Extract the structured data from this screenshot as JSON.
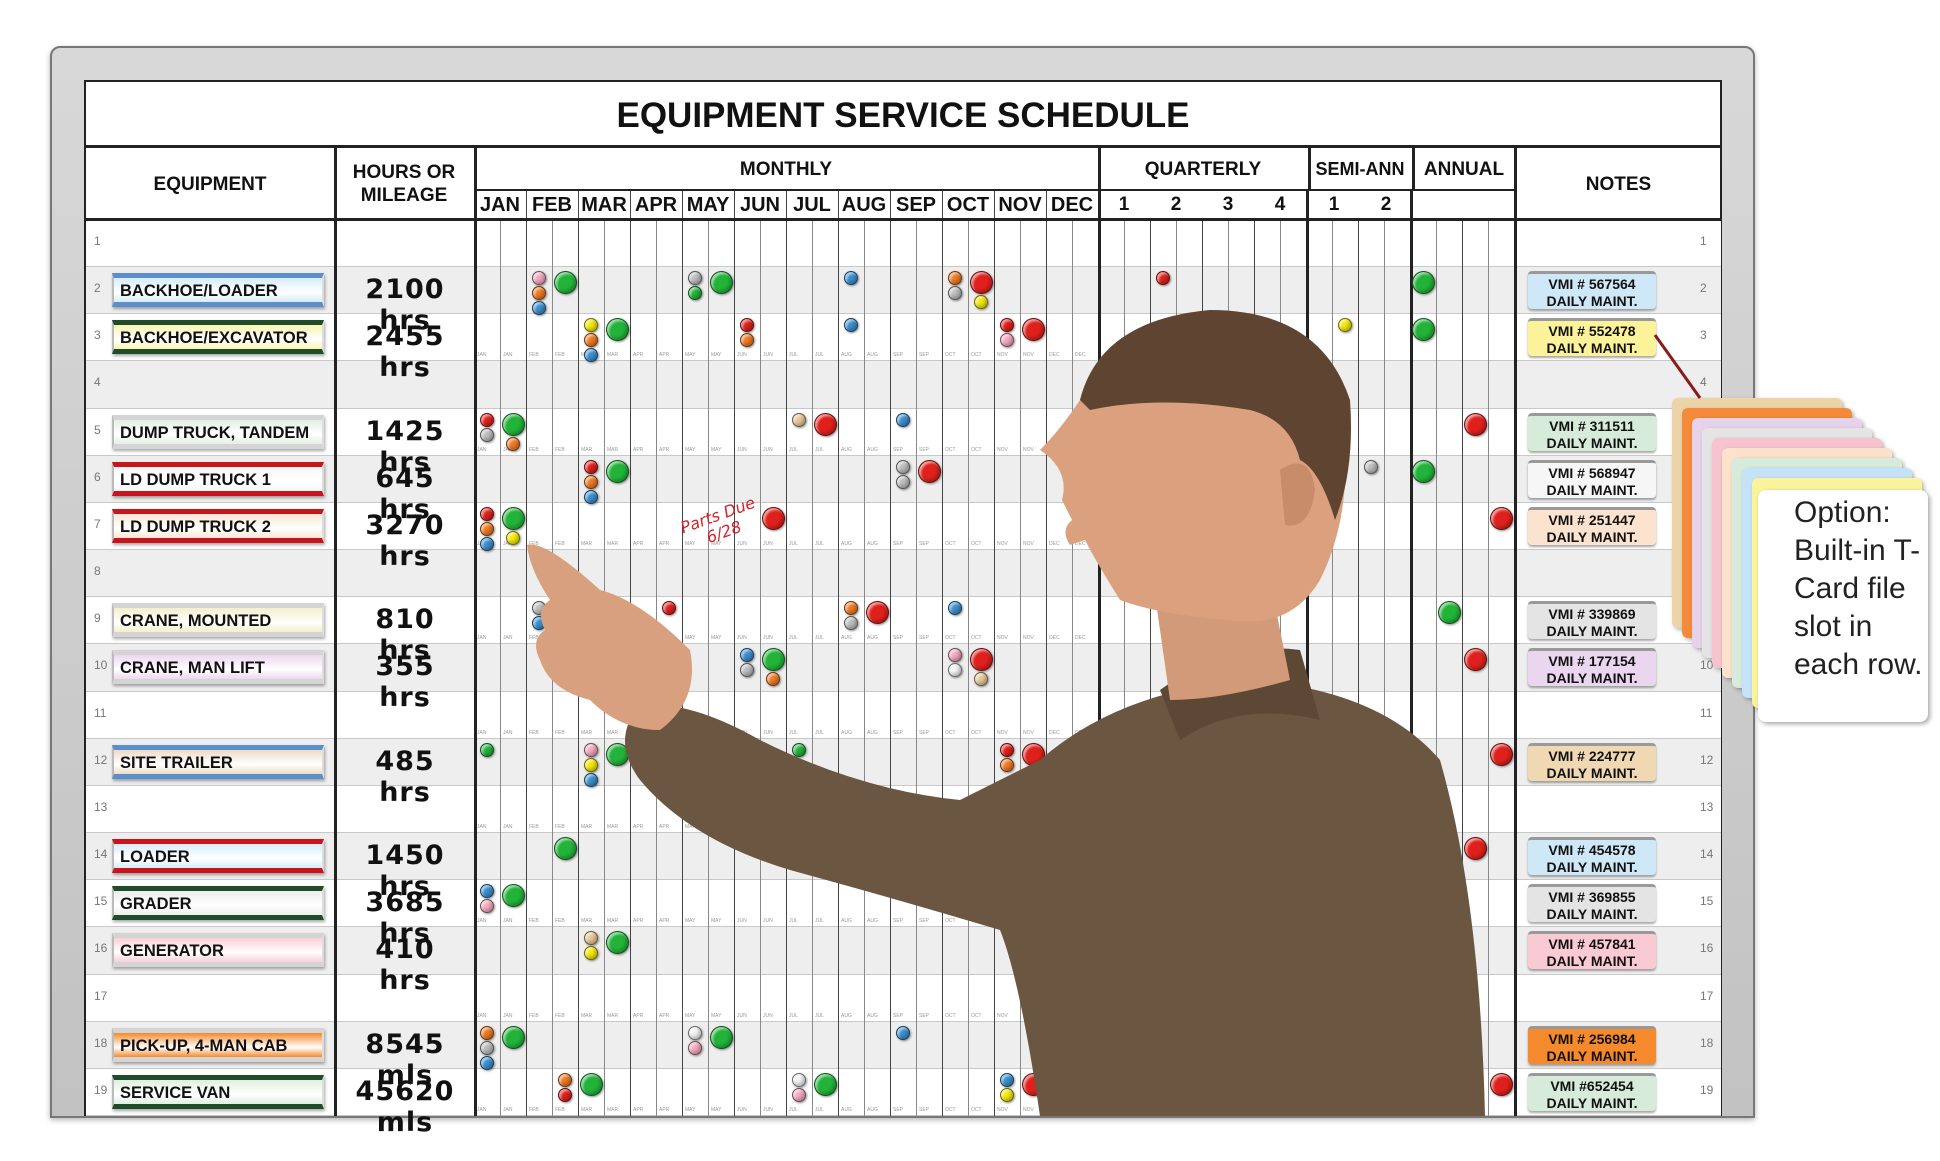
{
  "title": "EQUIPMENT SERVICE SCHEDULE",
  "headers": {
    "equipment": "EQUIPMENT",
    "hours": "HOURS OR MILEAGE",
    "monthly": "MONTHLY",
    "quarterly": "QUARTERLY",
    "semi_annual": "SEMI-ANN",
    "annual": "ANNUAL",
    "notes": "NOTES"
  },
  "months": [
    "JAN",
    "FEB",
    "MAR",
    "APR",
    "MAY",
    "JUN",
    "JUL",
    "AUG",
    "SEP",
    "OCT",
    "NOV",
    "DEC"
  ],
  "quarters": [
    "1",
    "2",
    "3",
    "4"
  ],
  "semis": [
    "1",
    "2"
  ],
  "row_numbers": [
    "1",
    "2",
    "3",
    "4",
    "5",
    "6",
    "7",
    "8",
    "9",
    "10",
    "11",
    "12",
    "13",
    "14",
    "15",
    "16",
    "17",
    "18",
    "19"
  ],
  "rows": [
    {
      "n": 2,
      "equipment": "BACKHOE/LOADER",
      "label_bg": "#d6ecf8",
      "label_border": "#5b8fc9",
      "hours": "2100 hrs",
      "note_id": "VMI # 567564",
      "note_text": "DAILY MAINT.",
      "note_color": "#cfe8f8"
    },
    {
      "n": 3,
      "equipment": "BACKHOE/EXCAVATOR",
      "label_bg": "#fbf4b0",
      "label_border": "#1f4d2a",
      "hours": "2455 hrs",
      "note_id": "VMI # 552478",
      "note_text": "DAILY MAINT.",
      "note_color": "#fbf29a"
    },
    {
      "n": 5,
      "equipment": "DUMP TRUCK, TANDEM",
      "label_bg": "#e3efe2",
      "label_border": "#d4d4d4",
      "hours": "1425 hrs",
      "note_id": "VMI # 311511",
      "note_text": "DAILY MAINT.",
      "note_color": "#d7ebdb"
    },
    {
      "n": 6,
      "equipment": "LD DUMP TRUCK 1",
      "label_bg": "#f7f7f7",
      "label_border": "#c8141c",
      "hours": "645 hrs",
      "note_id": "VMI # 568947",
      "note_text": "DAILY MAINT.",
      "note_color": "#f6f6f6"
    },
    {
      "n": 7,
      "equipment": "LD DUMP TRUCK 2",
      "label_bg": "#fbe6d6",
      "label_border": "#c8141c",
      "hours": "3270 hrs",
      "note_id": "VMI # 251447",
      "note_text": "DAILY MAINT.",
      "note_color": "#fce3cf"
    },
    {
      "n": 9,
      "equipment": "CRANE, MOUNTED",
      "label_bg": "#f4eecb",
      "label_border": "#d4d4d4",
      "hours": "810 hrs",
      "note_id": "VMI # 339869",
      "note_text": "DAILY MAINT.",
      "note_color": "#e4e4e4"
    },
    {
      "n": 10,
      "equipment": "CRANE, MAN LIFT",
      "label_bg": "#ecd8ee",
      "label_border": "#d4d4d4",
      "hours": "355 hrs",
      "note_id": "VMI # 177154",
      "note_text": "DAILY MAINT.",
      "note_color": "#ead6ef"
    },
    {
      "n": 12,
      "equipment": "SITE TRAILER",
      "label_bg": "#ecdcc6",
      "label_border": "#5b8fc9",
      "hours": "485 hrs",
      "note_id": "VMI # 224777",
      "note_text": "DAILY MAINT.",
      "note_color": "#f0d9b2"
    },
    {
      "n": 14,
      "equipment": "LOADER",
      "label_bg": "#d6ecf8",
      "label_border": "#c8141c",
      "hours": "1450 hrs",
      "note_id": "VMI # 454578",
      "note_text": "DAILY MAINT.",
      "note_color": "#cfe8f8"
    },
    {
      "n": 15,
      "equipment": "GRADER",
      "label_bg": "#ededed",
      "label_border": "#1f4d2a",
      "hours": "3685 hrs",
      "note_id": "VMI # 369855",
      "note_text": "DAILY MAINT.",
      "note_color": "#e4e4e4"
    },
    {
      "n": 16,
      "equipment": "GENERATOR",
      "label_bg": "#f9cfd8",
      "label_border": "#d4d4d4",
      "hours": "410 hrs",
      "note_id": "VMI # 457841",
      "note_text": "DAILY MAINT.",
      "note_color": "#f9c9d4"
    },
    {
      "n": 18,
      "equipment": "PICK-UP, 4-MAN CAB",
      "label_bg": "#f48a2c",
      "label_border": "#d4d4d4",
      "hours": "8545 mls",
      "note_id": "VMI # 256984",
      "note_text": "DAILY MAINT.",
      "note_color": "#f48a2c"
    },
    {
      "n": 19,
      "equipment": "SERVICE VAN",
      "label_bg": "#e0efe0",
      "label_border": "#1f4d2a",
      "hours": "45620 mls",
      "note_id": "VMI #652454",
      "note_text": "DAILY MAINT.",
      "note_color": "#d7ebdb"
    }
  ],
  "magnet_colors": {
    "red": "#e0201c",
    "green": "#22b339",
    "orange": "#f07a22",
    "blue": "#3a8fd0",
    "gray": "#bdbdbd",
    "pink": "#f6a8c0",
    "yellow": "#f5e800",
    "tan": "#e8c896",
    "white": "#f4f4f4"
  },
  "magnets": [
    {
      "row": 2,
      "slot": 2,
      "small": [
        "pink",
        "orange",
        "blue"
      ]
    },
    {
      "row": 2,
      "slot": 3,
      "big": "green"
    },
    {
      "row": 2,
      "slot": 8,
      "small": [
        "gray",
        "green"
      ]
    },
    {
      "row": 2,
      "slot": 9,
      "big": "green"
    },
    {
      "row": 2,
      "slot": 14,
      "small": [
        "blue"
      ]
    },
    {
      "row": 2,
      "slot": 18,
      "small": [
        "orange",
        "gray"
      ]
    },
    {
      "row": 2,
      "slot": 19,
      "big": "red",
      "small": [
        "yellow"
      ]
    },
    {
      "row": 2,
      "slot": 26,
      "small": [
        "red"
      ]
    },
    {
      "row": 2,
      "slot": 36,
      "big": "green"
    },
    {
      "row": 3,
      "slot": 4,
      "small": [
        "yellow",
        "orange",
        "blue"
      ]
    },
    {
      "row": 3,
      "slot": 5,
      "big": "green"
    },
    {
      "row": 3,
      "slot": 10,
      "small": [
        "red",
        "orange"
      ]
    },
    {
      "row": 3,
      "slot": 14,
      "small": [
        "blue"
      ]
    },
    {
      "row": 3,
      "slot": 20,
      "small": [
        "red",
        "pink"
      ]
    },
    {
      "row": 3,
      "slot": 21,
      "big": "red"
    },
    {
      "row": 3,
      "slot": 33,
      "small": [
        "yellow"
      ]
    },
    {
      "row": 3,
      "slot": 36,
      "big": "green"
    },
    {
      "row": 5,
      "slot": 0,
      "small": [
        "red",
        "gray"
      ]
    },
    {
      "row": 5,
      "slot": 1,
      "big": "green",
      "small": [
        "orange"
      ]
    },
    {
      "row": 5,
      "slot": 12,
      "small": [
        "tan"
      ]
    },
    {
      "row": 5,
      "slot": 13,
      "big": "red"
    },
    {
      "row": 5,
      "slot": 16,
      "small": [
        "blue"
      ]
    },
    {
      "row": 5,
      "slot": 38,
      "big": "red"
    },
    {
      "row": 6,
      "slot": 4,
      "small": [
        "red",
        "orange",
        "blue"
      ]
    },
    {
      "row": 6,
      "slot": 5,
      "big": "green"
    },
    {
      "row": 6,
      "slot": 16,
      "small": [
        "gray",
        "gray"
      ]
    },
    {
      "row": 6,
      "slot": 17,
      "big": "red"
    },
    {
      "row": 6,
      "slot": 34,
      "small": [
        "gray"
      ]
    },
    {
      "row": 6,
      "slot": 36,
      "big": "green"
    },
    {
      "row": 7,
      "slot": 0,
      "small": [
        "red",
        "orange",
        "blue"
      ]
    },
    {
      "row": 7,
      "slot": 1,
      "big": "green",
      "small": [
        "yellow"
      ]
    },
    {
      "row": 7,
      "slot": 11,
      "big": "red"
    },
    {
      "row": 7,
      "slot": 39,
      "big": "red"
    },
    {
      "row": 9,
      "slot": 2,
      "small": [
        "gray",
        "blue"
      ]
    },
    {
      "row": 9,
      "slot": 3,
      "big": "green"
    },
    {
      "row": 9,
      "slot": 7,
      "small": [
        "red"
      ]
    },
    {
      "row": 9,
      "slot": 14,
      "small": [
        "orange",
        "gray"
      ]
    },
    {
      "row": 9,
      "slot": 15,
      "big": "red"
    },
    {
      "row": 9,
      "slot": 18,
      "small": [
        "blue"
      ]
    },
    {
      "row": 9,
      "slot": 37,
      "big": "green"
    },
    {
      "row": 10,
      "slot": 10,
      "small": [
        "blue",
        "gray"
      ]
    },
    {
      "row": 10,
      "slot": 11,
      "big": "green",
      "small": [
        "orange"
      ]
    },
    {
      "row": 10,
      "slot": 18,
      "small": [
        "pink",
        "white"
      ]
    },
    {
      "row": 10,
      "slot": 19,
      "big": "red",
      "small": [
        "tan"
      ]
    },
    {
      "row": 10,
      "slot": 38,
      "big": "red"
    },
    {
      "row": 12,
      "slot": 0,
      "small": [
        "green"
      ]
    },
    {
      "row": 12,
      "slot": 4,
      "small": [
        "pink",
        "yellow",
        "blue"
      ]
    },
    {
      "row": 12,
      "slot": 5,
      "big": "green"
    },
    {
      "row": 12,
      "slot": 12,
      "small": [
        "green"
      ]
    },
    {
      "row": 12,
      "slot": 20,
      "small": [
        "red",
        "orange"
      ]
    },
    {
      "row": 12,
      "slot": 21,
      "big": "red"
    },
    {
      "row": 12,
      "slot": 39,
      "big": "red"
    },
    {
      "row": 14,
      "slot": 3,
      "big": "green"
    },
    {
      "row": 14,
      "slot": 17,
      "big": "red"
    },
    {
      "row": 14,
      "slot": 38,
      "big": "red"
    },
    {
      "row": 15,
      "slot": 0,
      "small": [
        "blue",
        "pink"
      ]
    },
    {
      "row": 15,
      "slot": 1,
      "big": "green"
    },
    {
      "row": 15,
      "slot": 18,
      "small": [
        "yellow"
      ]
    },
    {
      "row": 15,
      "slot": 19,
      "big": "red"
    },
    {
      "row": 16,
      "slot": 4,
      "small": [
        "tan",
        "yellow"
      ]
    },
    {
      "row": 16,
      "slot": 5,
      "big": "green"
    },
    {
      "row": 18,
      "slot": 0,
      "small": [
        "orange",
        "gray",
        "blue"
      ]
    },
    {
      "row": 18,
      "slot": 1,
      "big": "green"
    },
    {
      "row": 18,
      "slot": 8,
      "small": [
        "white",
        "pink"
      ]
    },
    {
      "row": 18,
      "slot": 9,
      "big": "green"
    },
    {
      "row": 18,
      "slot": 16,
      "small": [
        "blue"
      ]
    },
    {
      "row": 19,
      "slot": 3,
      "small": [
        "orange",
        "red"
      ]
    },
    {
      "row": 19,
      "slot": 4,
      "big": "green"
    },
    {
      "row": 19,
      "slot": 12,
      "small": [
        "white",
        "pink"
      ]
    },
    {
      "row": 19,
      "slot": 13,
      "big": "green"
    },
    {
      "row": 19,
      "slot": 20,
      "small": [
        "blue",
        "yellow"
      ]
    },
    {
      "row": 19,
      "slot": 21,
      "big": "red"
    },
    {
      "row": 19,
      "slot": 39,
      "big": "red"
    }
  ],
  "annotation": {
    "line1": "Parts Due",
    "line2": "6/28",
    "color": "#d2222a"
  },
  "callout": {
    "text": "Option: Built-in T-Card file slot in each row.",
    "card_colors": [
      "#ecd3a8",
      "#f48a3a",
      "#e6d2ea",
      "#e4e4e4",
      "#f7c3cf",
      "#fce1cb",
      "#d6ebdc",
      "#c6e2f6",
      "#fbf39b"
    ]
  }
}
